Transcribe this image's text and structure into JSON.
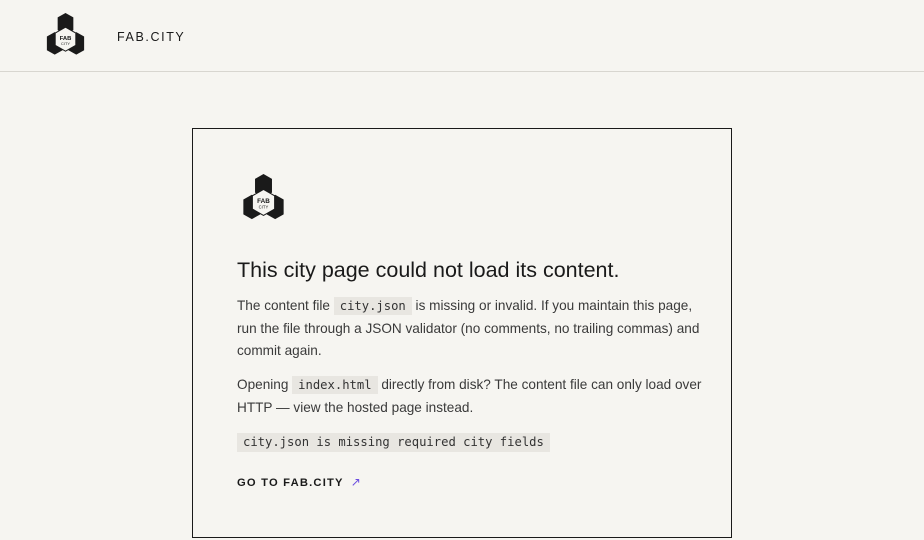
{
  "header": {
    "brand_name": "FAB.CITY",
    "logo_text_top": "FAB",
    "logo_text_bottom": "CITY"
  },
  "card": {
    "logo_text_top": "FAB",
    "logo_text_bottom": "CITY",
    "title": "This city page could not load its content.",
    "p1_before": "The content file ",
    "p1_code": "city.json",
    "p1_after": " is missing or invalid. If you maintain this page, run the file through a JSON validator (no comments, no trailing commas) and commit again.",
    "p2_before": "Opening ",
    "p2_code": "index.html",
    "p2_after": " directly from disk? The content file can only load over HTTP — view the hosted page instead.",
    "error_message": "city.json is missing required city fields",
    "link_label": "GO TO FAB.CITY",
    "link_arrow": "↗"
  },
  "colors": {
    "background": "#f6f5f1",
    "text": "#1a1a1a",
    "body_text": "#3a3a3a",
    "code_background": "#e8e6e1",
    "accent": "#6b4de0"
  }
}
